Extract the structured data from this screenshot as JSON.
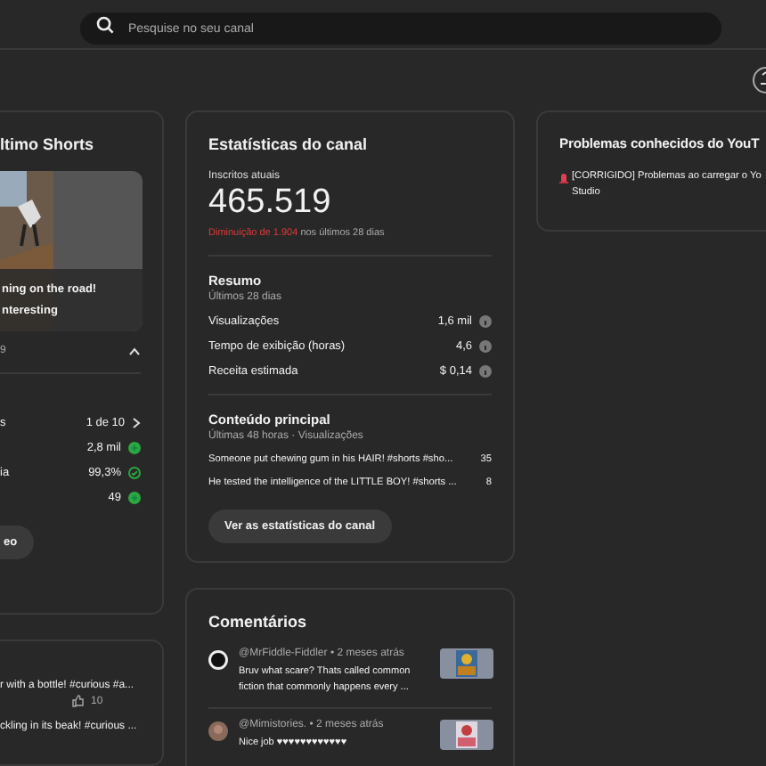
{
  "search": {
    "placeholder": "Pesquise no seu canal"
  },
  "latest_short": {
    "title": "ltimo Shorts",
    "overlay_lines": [
      "ning on the road!",
      "nteresting"
    ],
    "meta": "9",
    "expanded": true,
    "rows": [
      {
        "label": "s",
        "value": "1 de 10",
        "kind": "next"
      },
      {
        "label": "",
        "value": "2,8 mil",
        "kind": "good"
      },
      {
        "label": "ia",
        "value": "99,3%",
        "kind": "check"
      },
      {
        "label": "",
        "value": "49",
        "kind": "good"
      }
    ],
    "button": "eo"
  },
  "shorts_list": {
    "items": [
      {
        "title": "r with a bottle! #curious #a...",
        "likes": "10"
      },
      {
        "title": "ckling in its beak! #curious ..."
      }
    ]
  },
  "channel_stats": {
    "title": "Estatísticas do canal",
    "subs_label": "Inscritos atuais",
    "subs": "465.519",
    "change": "Diminuição de 1.904",
    "change_rest": "nos últimos 28 dias",
    "summary_title": "Resumo",
    "summary_period": "Últimos 28 dias",
    "summary": [
      {
        "label": "Visualizações",
        "value": "1,6 mil"
      },
      {
        "label": "Tempo de exibição (horas)",
        "value": "4,6"
      },
      {
        "label": "Receita estimada",
        "value": "$ 0,14"
      }
    ],
    "top_title": "Conteúdo principal",
    "top_period": "Últimas 48 horas · Visualizações",
    "top": [
      {
        "title": "Someone put chewing gum in his HAIR! #shorts #sho...",
        "value": "35"
      },
      {
        "title": "He tested the intelligence of the LITTLE BOY! #shorts ...",
        "value": "8"
      }
    ],
    "button": "Ver as estatísticas do canal"
  },
  "comments": {
    "title": "Comentários",
    "items": [
      {
        "author": "@MrFiddle-Fiddler",
        "time": "• 2 meses atrás",
        "text": "Bruv what scare? Thats called common fiction that commonly happens every ..."
      },
      {
        "author": "@Mimistories.",
        "time": "• 2 meses atrás",
        "text": "Nice job ♥♥♥♥♥♥♥♥♥♥♥♥"
      }
    ]
  },
  "known_issues": {
    "title": "Problemas conhecidos do YouT",
    "items": [
      {
        "text": "[CORRIGIDO] Problemas ao carregar o Yo\nStudio"
      }
    ]
  }
}
